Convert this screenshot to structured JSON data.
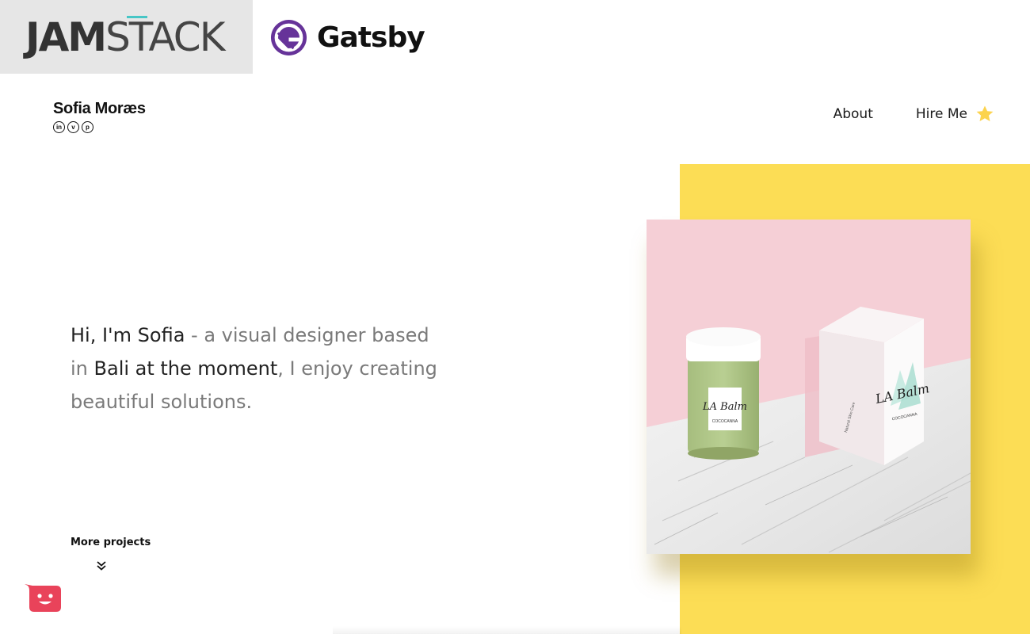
{
  "badges": {
    "jamstack": {
      "bold": "JAM",
      "light": "STACK"
    },
    "gatsby": {
      "label": "Gatsby"
    }
  },
  "header": {
    "name": "Sofia Moræs",
    "socials": [
      {
        "icon": "linkedin-icon",
        "glyph": "in"
      },
      {
        "icon": "vimeo-icon",
        "glyph": "v"
      },
      {
        "icon": "pinterest-icon",
        "glyph": "p"
      }
    ],
    "nav": {
      "about": "About",
      "hire": "Hire Me",
      "hire_icon": "star-icon"
    }
  },
  "hero": {
    "part1": "Hi, I'm Sofia",
    "part2": " - a visual designer based in ",
    "part3": "Bali at the moment",
    "part4": ", I enjoy creating beautiful solutions."
  },
  "more_projects": {
    "label": "More projects",
    "icon": "double-chevron-down-icon"
  },
  "artwork": {
    "jar_label": {
      "brand": "LA Balm",
      "sub": "COCOCANNA"
    },
    "box_label": {
      "brand": "LA Balm",
      "sub": "COCOCANNA",
      "side": "Natural Skin Care"
    }
  },
  "colors": {
    "accent_yellow": "#fcdd55",
    "pink": "#f5cfd6",
    "gatsby_purple": "#663399",
    "chat_red": "#e9435a",
    "star": "#fcd34d"
  }
}
